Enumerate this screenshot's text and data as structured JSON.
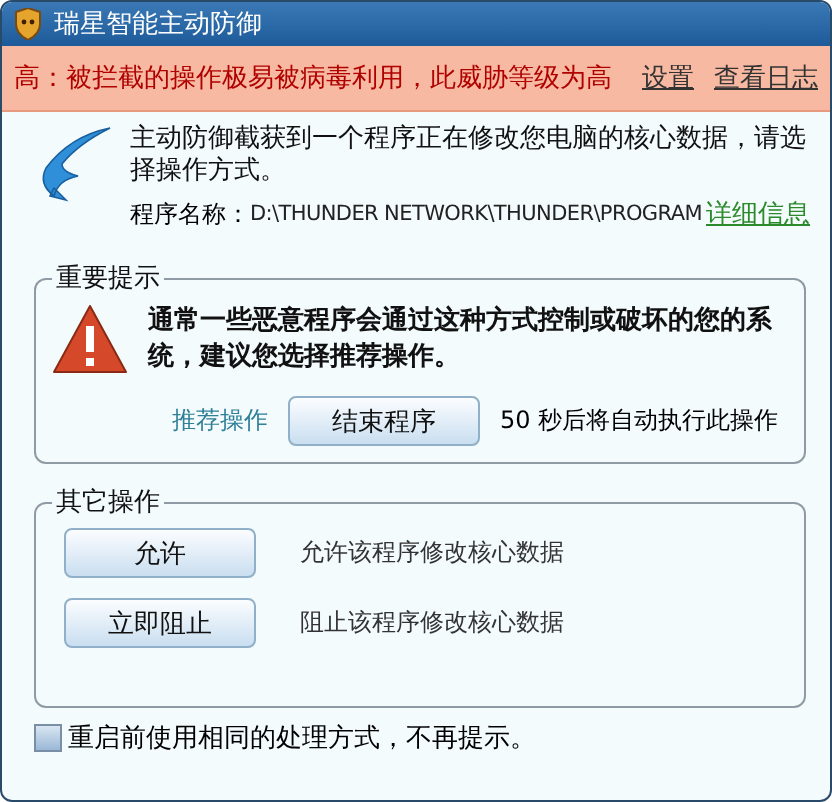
{
  "window": {
    "title": "瑞星智能主动防御"
  },
  "alert_bar": {
    "message": "高：被拦截的操作极易被病毒利用，此威胁等级为高",
    "links": [
      "设置",
      "查看日志"
    ]
  },
  "intro": {
    "message": "主动防御截获到一个程序正在修改您电脑的核心数据，请选择操作方式。",
    "program_label": "程序名称：",
    "program_path": "D:\\THUNDER NETWORK\\THUNDER\\PROGRAM",
    "details_link": "详细信息"
  },
  "important": {
    "legend": "重要提示",
    "warning": "通常一些恶意程序会通过这种方式控制或破坏的您的系统，建议您选择推荐操作。",
    "recommended_label": "推荐操作",
    "recommended_button": "结束程序",
    "countdown": "50 秒后将自动执行此操作"
  },
  "other": {
    "legend": "其它操作",
    "actions": [
      {
        "button": "允许",
        "description": "允许该程序修改核心数据"
      },
      {
        "button": "立即阻止",
        "description": "阻止该程序修改核心数据"
      }
    ]
  },
  "remember": {
    "label": "重启前使用相同的处理方式，不再提示。",
    "checked": false
  }
}
